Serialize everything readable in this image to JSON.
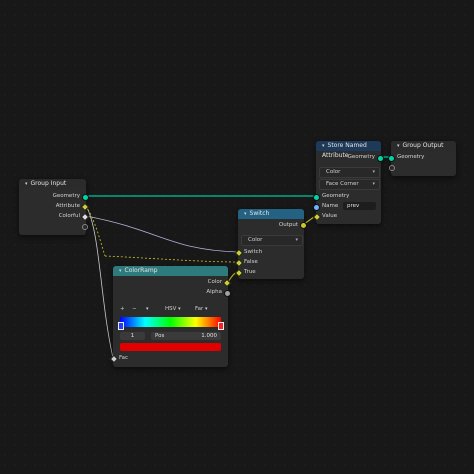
{
  "group_input": {
    "title": "Group Input",
    "outputs": [
      "Geometry",
      "Attribute",
      "Colorful"
    ]
  },
  "switch": {
    "title": "Switch",
    "output": "Output",
    "type": "Color",
    "inputs": [
      "Switch",
      "False",
      "True"
    ]
  },
  "store": {
    "title": "Store Named Attribute",
    "output": "Geometry",
    "data_type": "Color",
    "domain": "Face Corner",
    "inputs": [
      "Geometry",
      "Name",
      "Value"
    ],
    "name_value": "prev"
  },
  "group_output": {
    "title": "Group Output",
    "input": "Geometry"
  },
  "colorramp": {
    "title": "ColorRamp",
    "outputs": [
      "Color",
      "Alpha"
    ],
    "add": "+",
    "remove": "−",
    "mode": "HSV",
    "interp": "Far",
    "index": "1",
    "pos_label": "Pos",
    "pos_value": "1.000",
    "input": "Fac",
    "swatch_color": "#e00000"
  },
  "colors": {
    "geometry_socket": "#00d6a3",
    "group_header": "#1f3c3c",
    "converter_header": "#246283",
    "attribute_header": "#1d3a5a",
    "ramp_header": "#2e7b7d"
  }
}
